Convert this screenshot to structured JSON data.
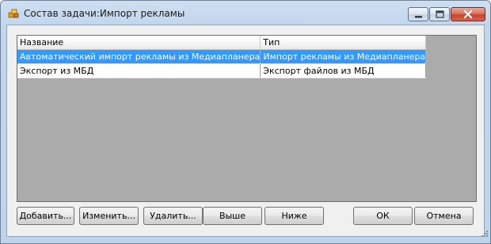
{
  "window": {
    "title": "Состав задачи:Импорт рекламы",
    "icon": "app-icon"
  },
  "grid": {
    "columns": [
      "Название",
      "Тип"
    ],
    "rows": [
      {
        "name": "Автоматический импорт рекламы из Медиапланера",
        "type": "Импорт рекламы из Медиапланера",
        "selected": true
      },
      {
        "name": "Экспорт из МБД",
        "type": "Экспорт файлов из МБД",
        "selected": false
      }
    ]
  },
  "buttons": {
    "add": "Добавить...",
    "edit": "Изменить...",
    "delete": "Удалить...",
    "up": "Выше",
    "down": "Ниже",
    "ok": "ОК",
    "cancel": "Отмена"
  },
  "colors": {
    "selection": "#3399ff",
    "grid_background": "#ababab",
    "window_frame": "#bfd3ea",
    "close_button": "#c4432c"
  }
}
